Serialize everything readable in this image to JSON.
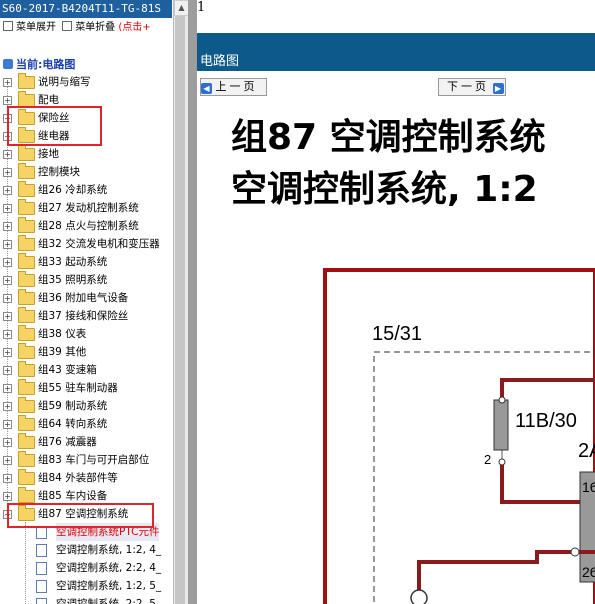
{
  "window": {
    "title": "S60-2017-B4204T11-TG-81S"
  },
  "toolbar": {
    "expand_label": "菜单展开",
    "collapse_label": "菜单折叠",
    "hint": "(点击+"
  },
  "current": {
    "label": "当前:电路图"
  },
  "tree": {
    "folders": [
      {
        "label": "说明与缩写"
      },
      {
        "label": "配电"
      },
      {
        "label": "保险丝"
      },
      {
        "label": "继电器"
      },
      {
        "label": "接地"
      },
      {
        "label": "控制模块"
      },
      {
        "label": "组26 冷却系统"
      },
      {
        "label": "组27 发动机控制系统"
      },
      {
        "label": "组28 点火与控制系统"
      },
      {
        "label": "组32 交流发电机和变压器"
      },
      {
        "label": "组33 起动系统"
      },
      {
        "label": "组35 照明系统"
      },
      {
        "label": "组36 附加电气设备"
      },
      {
        "label": "组37 接线和保险丝"
      },
      {
        "label": "组38 仪表"
      },
      {
        "label": "组39 其他"
      },
      {
        "label": "组43 变速箱"
      },
      {
        "label": "组55 驻车制动器"
      },
      {
        "label": "组59 制动系统"
      },
      {
        "label": "组64 转向系统"
      },
      {
        "label": "组76 减震器"
      },
      {
        "label": "组83 车门与可开启部位"
      },
      {
        "label": "组84 外装部件等"
      },
      {
        "label": "组85 车内设备"
      },
      {
        "label": "组87 空调控制系统"
      }
    ],
    "children": [
      {
        "label": "空调控制系统PTC元件"
      },
      {
        "label": "空调控制系统, 1:2, 4_"
      },
      {
        "label": "空调控制系统, 2:2, 4_"
      },
      {
        "label": "空调控制系统, 1:2, 5_"
      },
      {
        "label": "空调控制系统, 2:2, 5_"
      }
    ]
  },
  "content": {
    "page_number": "1",
    "header_title": "电路图",
    "prev_label": "上一页",
    "next_label": "下一页",
    "doc_title_line1": "组87 空调控制系统",
    "doc_title_line2": "空调控制系统, 1:2",
    "diagram": {
      "label_box": "15/31",
      "label_fuse": "11B/30",
      "label_pin": "2",
      "label_conn": "2A",
      "label_c1": "16",
      "label_c2": "26"
    }
  },
  "colors": {
    "header": "#0d5a8a",
    "title_bar": "#1e5f9e",
    "highlight_box": "#e0252a",
    "wire": "#8b1a1a"
  }
}
